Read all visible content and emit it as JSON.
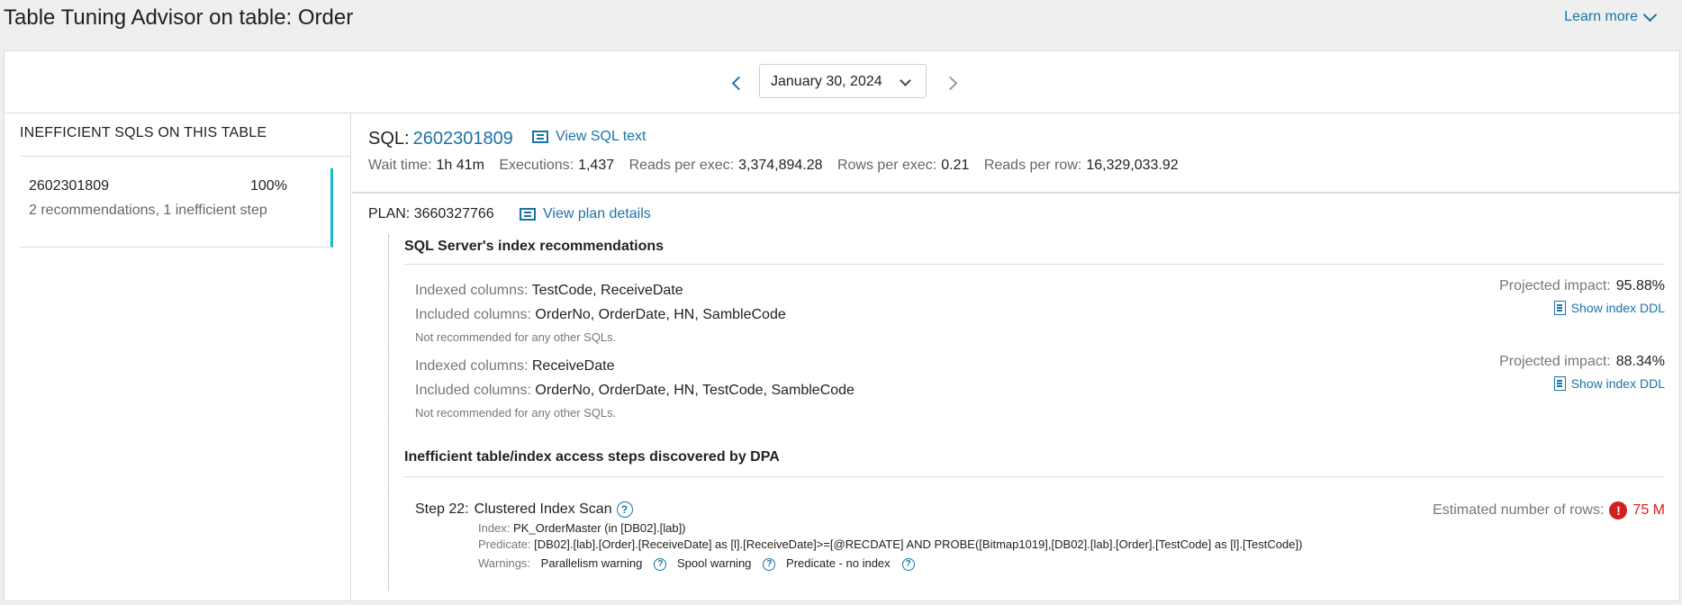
{
  "header": {
    "title": "Table Tuning Advisor on table: Order",
    "learn_more": "Learn more"
  },
  "date_nav": {
    "date": "January 30, 2024"
  },
  "sidebar": {
    "heading": "INEFFICIENT SQLS ON THIS TABLE",
    "items": [
      {
        "sql_id": "2602301809",
        "percent": "100%",
        "desc": "2 recommendations,  1 inefficient step"
      }
    ]
  },
  "sql": {
    "label": "SQL:",
    "id": "2602301809",
    "view_text": "View SQL text",
    "metrics": {
      "wait_label": "Wait time:",
      "wait": "1h 41m",
      "exec_label": "Executions:",
      "exec": "1,437",
      "reads_exec_label": "Reads per exec:",
      "reads_exec": "3,374,894.28",
      "rows_exec_label": "Rows per exec:",
      "rows_exec": "0.21",
      "reads_row_label": "Reads per row:",
      "reads_row": "16,329,033.92"
    }
  },
  "plan": {
    "label": "PLAN:",
    "id": "3660327766",
    "view_details": "View plan details"
  },
  "recommendations": {
    "heading": "SQL Server's index recommendations",
    "indexed_label": "Indexed columns:",
    "included_label": "Included columns:",
    "impact_label": "Projected impact:",
    "ddl_label": "Show index DDL",
    "items": [
      {
        "indexed": "TestCode, ReceiveDate",
        "included": "OrderNo, OrderDate, HN, SambleCode",
        "note": "Not recommended for any other SQLs.",
        "impact": "95.88%"
      },
      {
        "indexed": "ReceiveDate",
        "included": "OrderNo, OrderDate, HN, TestCode, SambleCode",
        "note": "Not recommended for any other SQLs.",
        "impact": "88.34%"
      }
    ]
  },
  "steps": {
    "heading": "Inefficient table/index access steps discovered by DPA",
    "step_label": "Step 22:",
    "step_name": "Clustered Index Scan",
    "est_label": "Estimated number of rows:",
    "est_value": "75 M",
    "index_label": "Index:",
    "index_value": "PK_OrderMaster (in [DB02].[lab])",
    "predicate_label": "Predicate:",
    "predicate_value": "[DB02].[lab].[Order].[ReceiveDate] as [l].[ReceiveDate]>=[@RECDATE] AND PROBE([Bitmap1019],[DB02].[lab].[Order].[TestCode] as [l].[TestCode])",
    "warnings_label": "Warnings:",
    "warnings": [
      "Parallelism warning",
      "Spool warning",
      "Predicate - no index"
    ]
  },
  "colors": {
    "link": "#1a73a8",
    "accent": "#18b8cf",
    "alert": "#d32020"
  }
}
